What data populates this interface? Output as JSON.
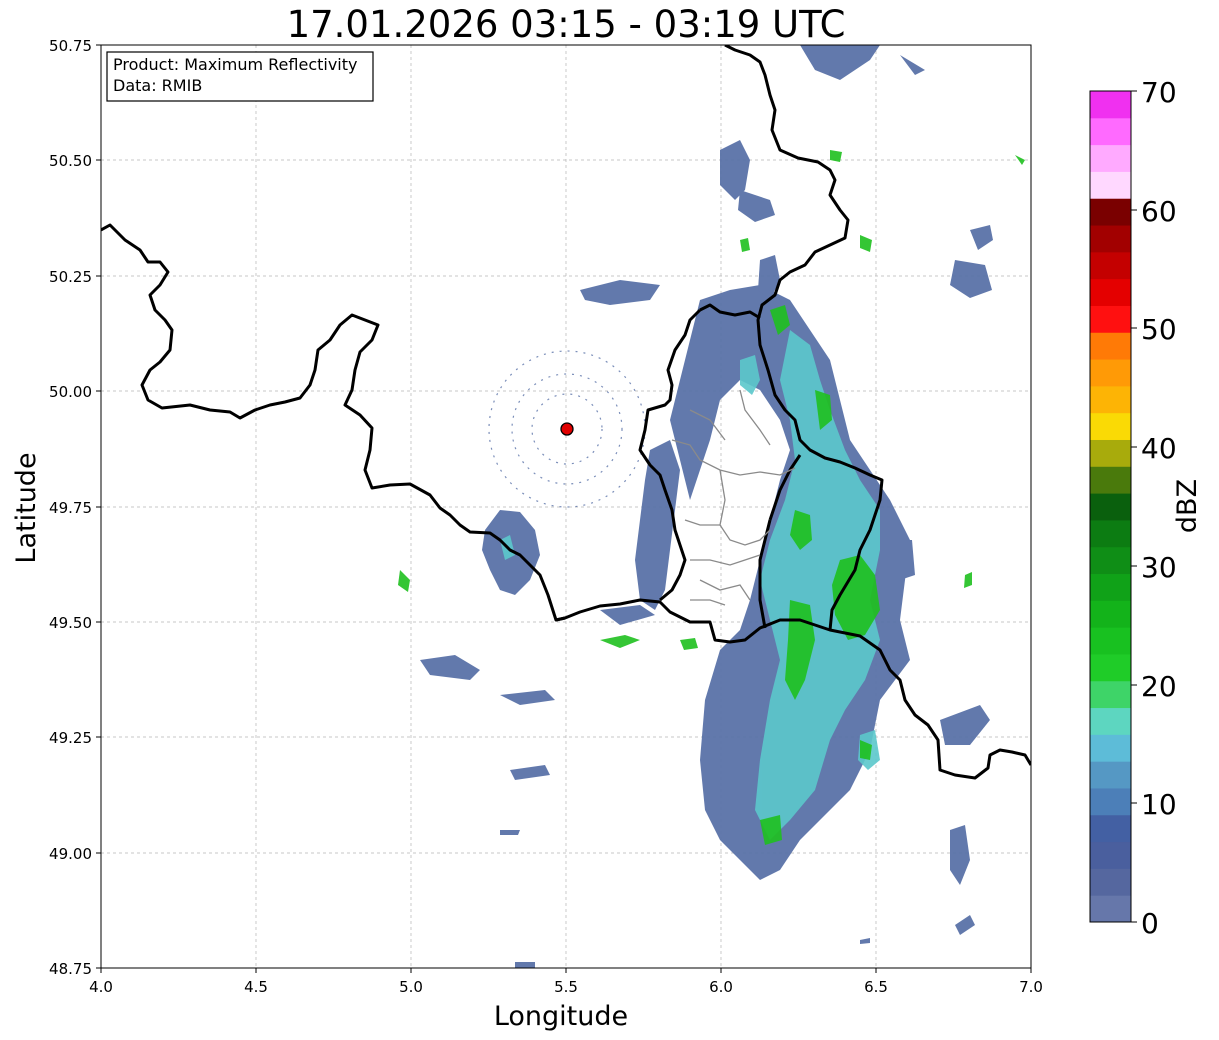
{
  "title": "17.01.2026 03:15 - 03:19 UTC",
  "info_box": {
    "product": "Product: Maximum Reflectivity",
    "data": "Data: RMIB"
  },
  "x_axis": {
    "label": "Longitude",
    "range": [
      4.0,
      7.0
    ],
    "ticks": [
      "4.0",
      "4.5",
      "5.0",
      "5.5",
      "6.0",
      "6.5",
      "7.0"
    ]
  },
  "y_axis": {
    "label": "Latitude",
    "range": [
      48.75,
      50.75
    ],
    "ticks": [
      "48.75",
      "49.00",
      "49.25",
      "49.50",
      "49.75",
      "50.00",
      "50.25",
      "50.50",
      "50.75"
    ]
  },
  "grid": true,
  "radar_site": {
    "lon": 5.505,
    "lat": 49.915,
    "color": "#e00000"
  },
  "colorbar": {
    "label": "dBZ",
    "range": [
      0,
      70
    ],
    "ticks": [
      "0",
      "10",
      "20",
      "30",
      "40",
      "50",
      "60",
      "70"
    ],
    "colors": [
      "#6677aa",
      "#55679f",
      "#4a5f9e",
      "#4360a3",
      "#4c7fb8",
      "#5598c4",
      "#5dbcd8",
      "#5dd6c0",
      "#3ed468",
      "#1fcc28",
      "#18c120",
      "#13b31a",
      "#10a218",
      "#0f8e16",
      "#0c7c12",
      "#0a600d",
      "#4a7a0c",
      "#a8ab0c",
      "#fada05",
      "#fdb405",
      "#ff9a06",
      "#ff7a06",
      "#ff1010",
      "#e40000",
      "#c40000",
      "#a20000",
      "#7a0000",
      "#ffd8ff",
      "#ffaaff",
      "#ff6aff",
      "#f030f0"
    ]
  },
  "precip_levels": {
    "light": "#5a72a8",
    "moderate": "#5cc8cc",
    "heavy": "#1fc01f"
  }
}
